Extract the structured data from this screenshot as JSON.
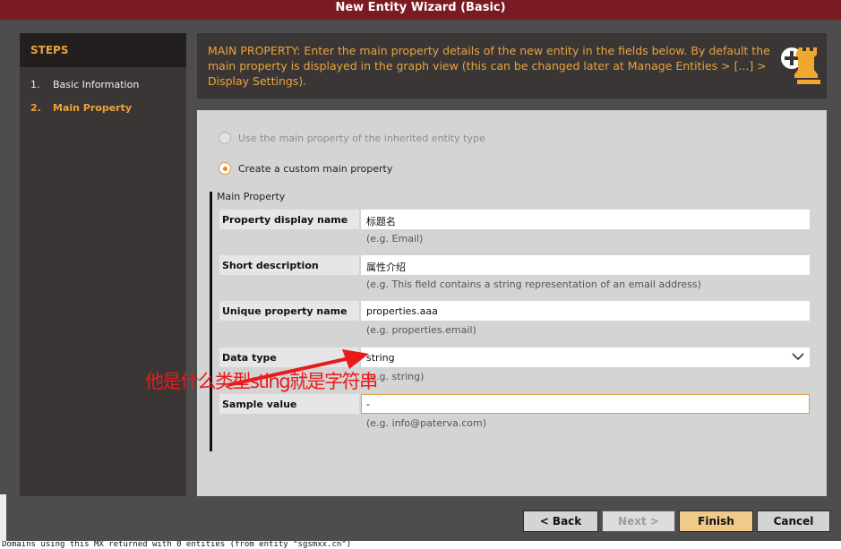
{
  "window": {
    "title": "New Entity Wizard (Basic)"
  },
  "steps": {
    "header": "STEPS",
    "items": [
      {
        "num": "1.",
        "label": "Basic Information",
        "active": false
      },
      {
        "num": "2.",
        "label": "Main Property",
        "active": true
      }
    ]
  },
  "info": {
    "text": "MAIN PROPERTY: Enter the main property details of the new entity in the fields below. By default the main property is displayed in the graph view (this can be changed later at Manage Entities > [...] > Display Settings).",
    "icon": "add-entity-chess-rook-icon"
  },
  "form": {
    "options": [
      {
        "label": "Use the main property of the inherited entity type",
        "checked": false,
        "enabled": false
      },
      {
        "label": "Create a custom main property",
        "checked": true,
        "enabled": true
      }
    ],
    "group_label": "Main Property",
    "fields": [
      {
        "label": "Property display name",
        "value": "标题名",
        "hint": "(e.g. Email)"
      },
      {
        "label": "Short description",
        "value": "属性介绍",
        "hint": "(e.g. This field contains a string representation of an email address)"
      },
      {
        "label": "Unique property name",
        "value": "properties.aaa",
        "hint": "(e.g. properties.email)"
      },
      {
        "label": "Data type",
        "value": "string",
        "hint": "(e.g. string)"
      },
      {
        "label": "Sample value",
        "value": "-",
        "hint": "(e.g. info@paterva.com)"
      }
    ]
  },
  "buttons": {
    "back": "< Back",
    "next": "Next >",
    "finish": "Finish",
    "cancel": "Cancel"
  },
  "annotation": {
    "text": "他是什么类型sting就是字符串",
    "color": "#e81b1b"
  },
  "console": {
    "text": "Domains using this MX returned with 0 entities (from entity \"sgsmxx.cn\")"
  },
  "colors": {
    "accent": "#e9a33b",
    "titlebar": "#7a1a22",
    "panel": "#3b3636"
  }
}
